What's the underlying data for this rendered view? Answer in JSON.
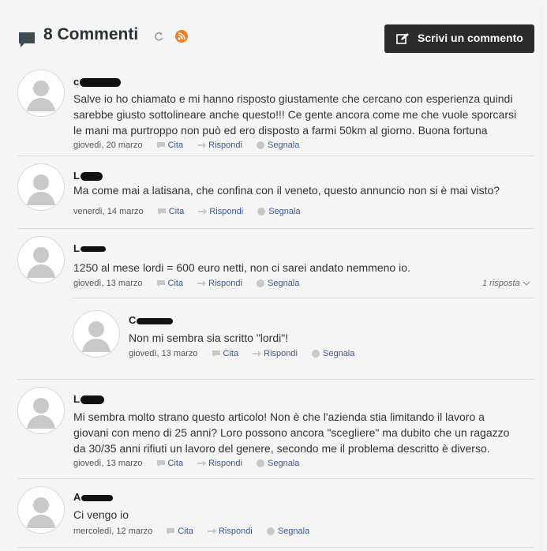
{
  "header": {
    "title": "8 Commenti",
    "write_button": "Scrivi un commento"
  },
  "actions": {
    "cita": "Cita",
    "rispondi": "Rispondi",
    "segnala": "Segnala"
  },
  "comments": [
    {
      "author_initial": "c",
      "text": "Salve io ho chiamato e mi hanno risposto giustamente che cercano con esperienza quindi sarebbe giusto sottolineare anche questo!!! Ce gente ancora come me che vuole sporcarsi le mani ma purtroppo non può ed ero disposto a farmi 50km al giorno. Buona fortuna",
      "date": "giovedì, 20 marzo"
    },
    {
      "author_initial": "L",
      "text": "Ma come mai a latisana, che confina con il veneto, questo annuncio non si è mai visto?",
      "date": "venerdì, 14 marzo"
    },
    {
      "author_initial": "L",
      "text": "1250 al mese lordi = 600 euro netti, non ci sarei andato nemmeno io.",
      "date": "giovedì, 13 marzo",
      "replies_label": "1 risposta"
    },
    {
      "author_initial": "C",
      "text": "Non mi sembra sia scritto \"lordi\"!",
      "date": "giovedì, 13 marzo"
    },
    {
      "author_initial": "L",
      "text": "Mi sembra molto strano questo articolo! Non è che l'azienda stia limitando il lavoro a giovani con meno di 25 anni? Loro possono ancora \"scegliere\" ma dubito che un ragazzo da 30/35 anni rifiuti un lavoro del genere, secondo me il problema descritto è diverso.",
      "date": "giovedì, 13 marzo"
    },
    {
      "author_initial": "A",
      "text": "Ci vengo io",
      "date": "mercoledì, 12 marzo"
    }
  ],
  "colors": {
    "accent_link": "#3b5998",
    "button_bg": "#2b2b2b",
    "rss": "#f27d20"
  }
}
